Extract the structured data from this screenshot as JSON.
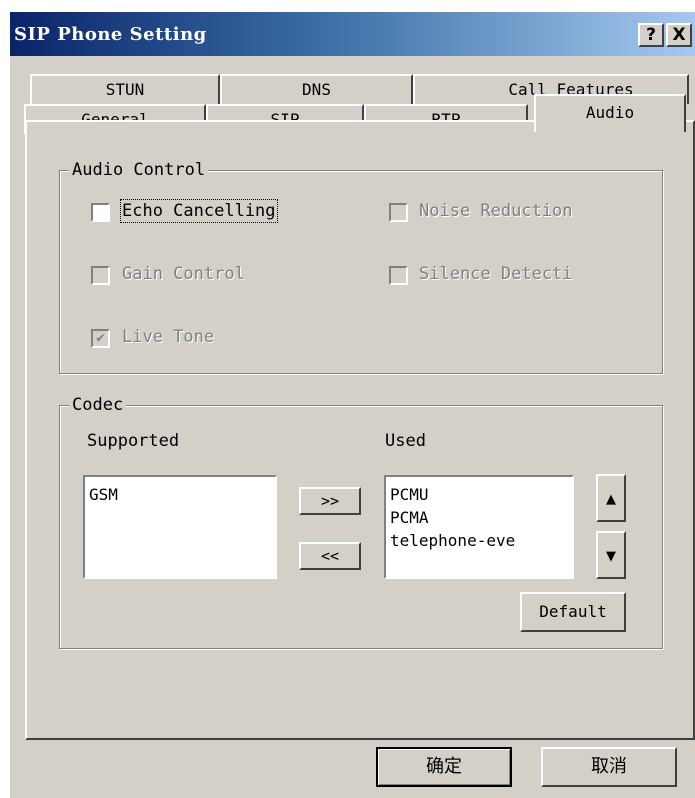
{
  "window": {
    "title": "SIP Phone Setting",
    "help_label": "?",
    "close_label": "X"
  },
  "tabs": {
    "row1": [
      {
        "label": "STUN"
      },
      {
        "label": "DNS"
      },
      {
        "label": "Call Features"
      }
    ],
    "row2": [
      {
        "label": "General"
      },
      {
        "label": "SIP"
      },
      {
        "label": "RTP"
      },
      {
        "label": "Audio",
        "selected": true
      }
    ]
  },
  "audio_control": {
    "legend": "Audio Control",
    "echo_cancelling": {
      "label": "Echo Cancelling",
      "checked": false,
      "enabled": true
    },
    "noise_reduction": {
      "label": "Noise Reduction",
      "checked": false,
      "enabled": false
    },
    "gain_control": {
      "label": "Gain Control",
      "checked": false,
      "enabled": false
    },
    "silence_detection": {
      "label": "Silence Detecti",
      "checked": false,
      "enabled": false
    },
    "live_tone": {
      "label": "Live Tone",
      "checked": true,
      "enabled": false
    }
  },
  "codec": {
    "legend": "Codec",
    "supported_label": "Supported",
    "used_label": "Used",
    "supported": [
      "GSM"
    ],
    "used": [
      "PCMU",
      "PCMA",
      "telephone-eve"
    ],
    "add_label": ">>",
    "remove_label": "<<",
    "up_icon": "▲",
    "down_icon": "▼",
    "default_label": "Default"
  },
  "footer": {
    "ok_label": "确定",
    "cancel_label": "取消"
  }
}
